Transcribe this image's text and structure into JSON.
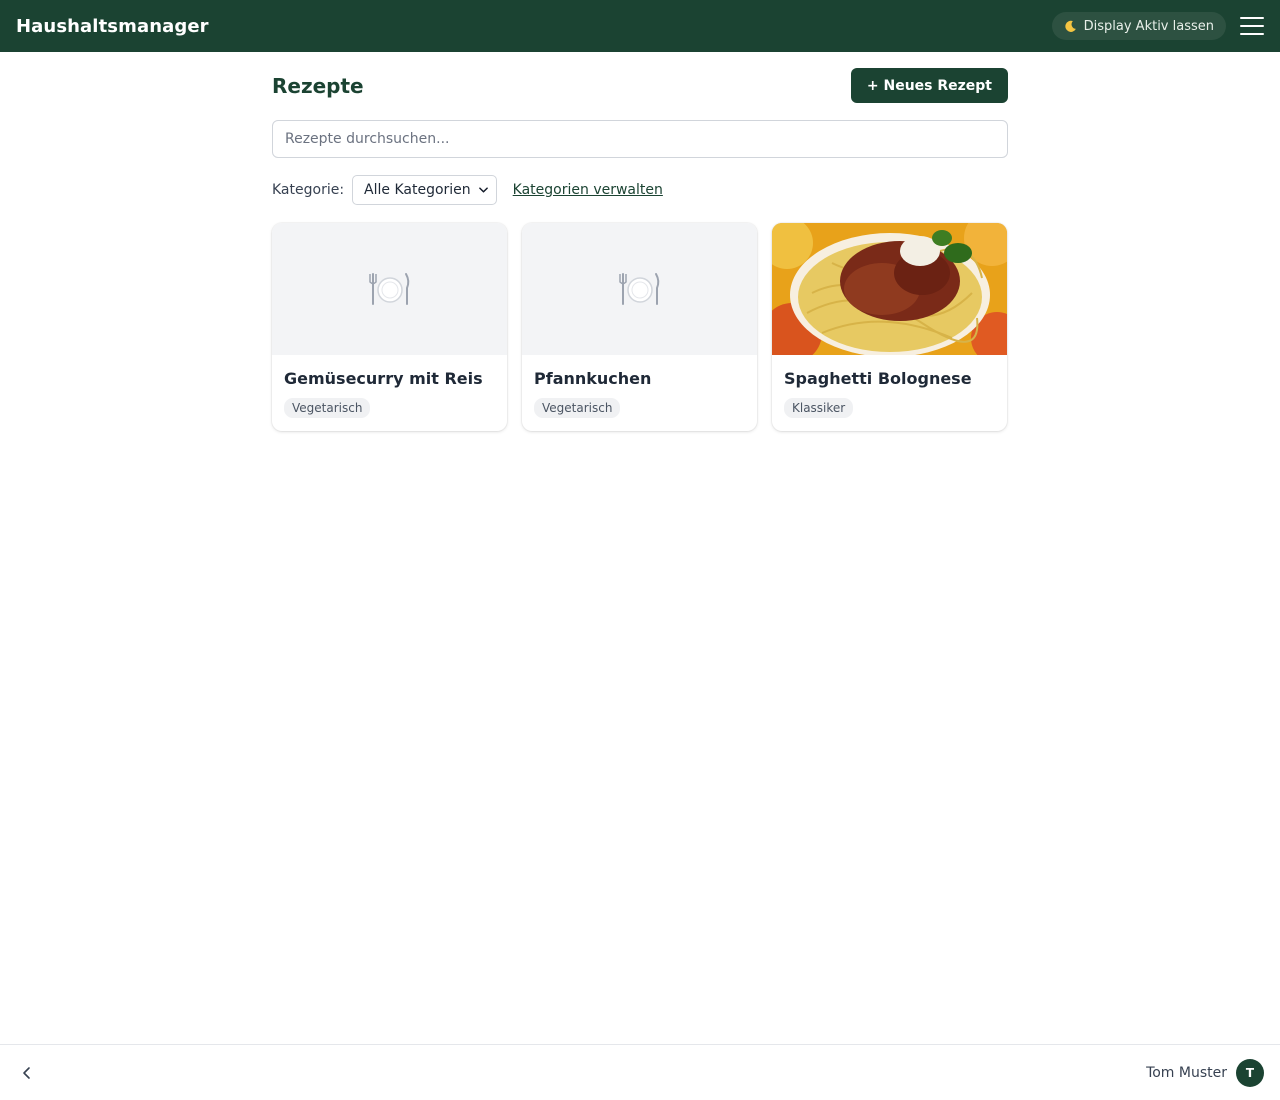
{
  "app": {
    "title": "Haushaltsmanager"
  },
  "header": {
    "wake_lock_label": "Display Aktiv lassen",
    "wake_lock_icon": "moon-icon",
    "menu_icon": "hamburger-icon"
  },
  "page": {
    "title": "Rezepte",
    "new_button_label": "+ Neues Rezept"
  },
  "search": {
    "placeholder": "Rezepte durchsuchen...",
    "value": ""
  },
  "filter": {
    "label": "Kategorie:",
    "selected": "Alle Kategorien",
    "manage_link": "Kategorien verwalten"
  },
  "recipes": [
    {
      "title": "Gemüsecurry mit Reis",
      "category": "Vegetarisch",
      "image": "plate-placeholder-icon"
    },
    {
      "title": "Pfannkuchen",
      "category": "Vegetarisch",
      "image": "plate-placeholder-icon"
    },
    {
      "title": "Spaghetti Bolognese",
      "category": "Klassiker",
      "image": "spaghetti-photo"
    }
  ],
  "footer": {
    "user_name": "Tom Muster",
    "avatar_initial": "T",
    "back_icon": "chevron-left-icon"
  },
  "colors": {
    "primary": "#1b4332",
    "accent_light": "#2d5141",
    "border": "#d1d5db",
    "tag_bg": "#f0f1f3"
  }
}
